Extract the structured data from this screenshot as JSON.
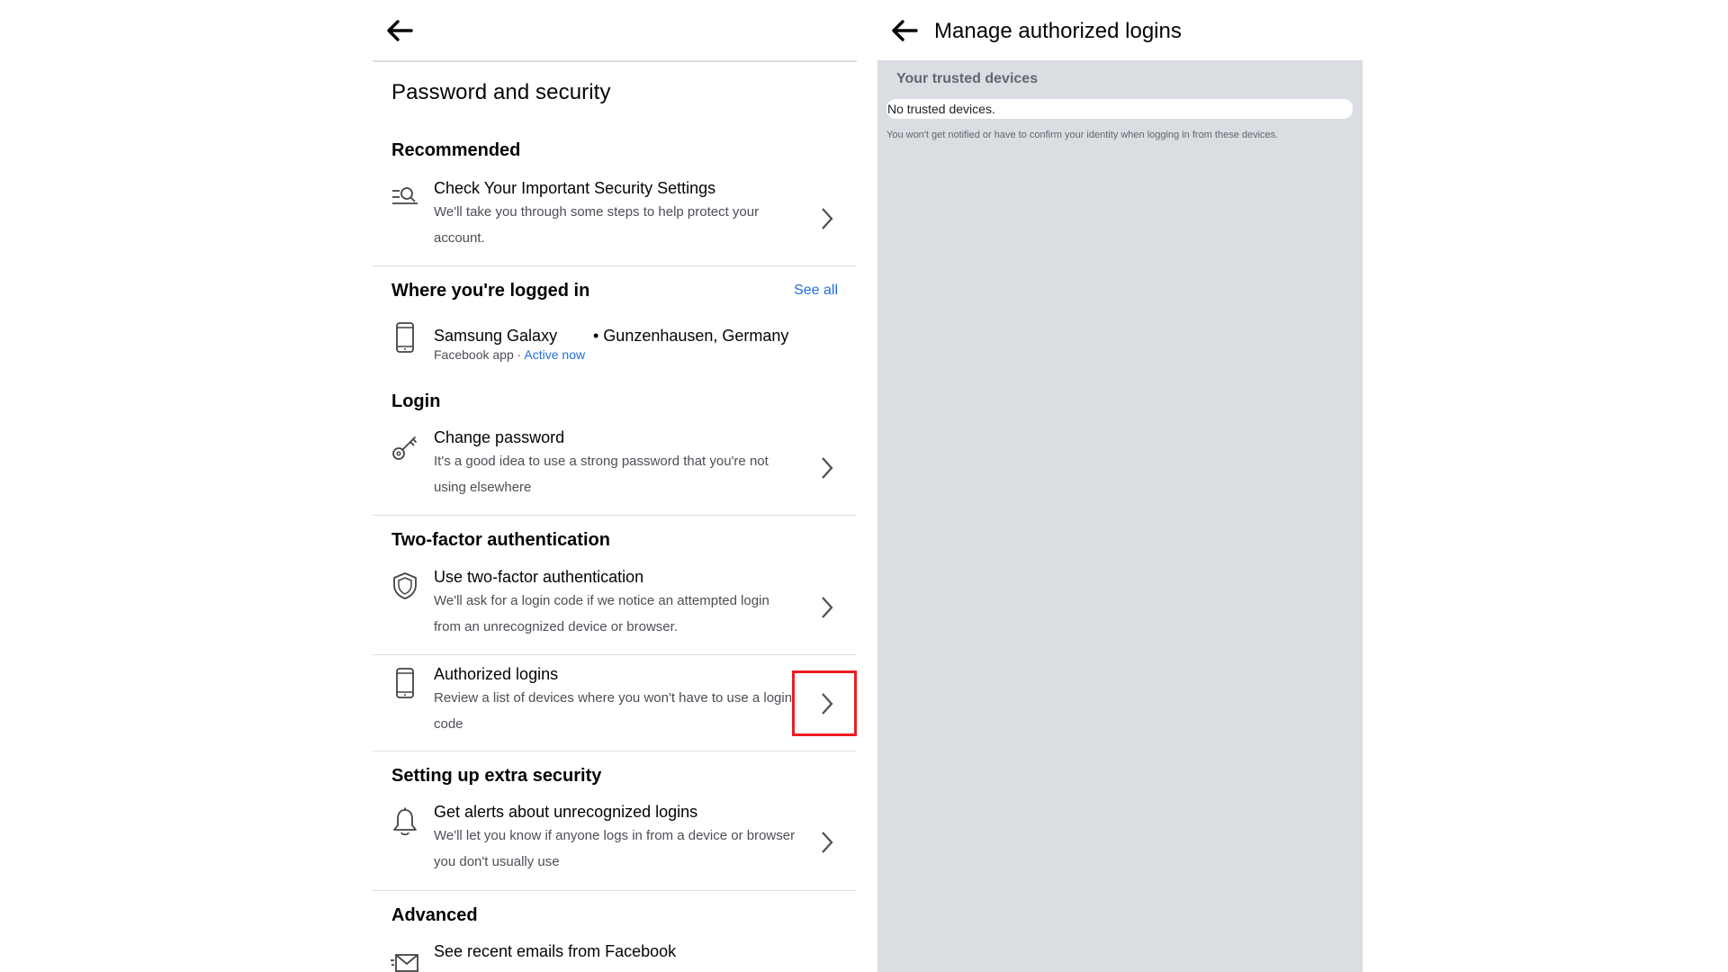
{
  "left_panel": {
    "page_title": "Password and security",
    "sections": {
      "recommended": {
        "title": "Recommended",
        "item": {
          "title": "Check Your Important Security Settings",
          "desc_line1": "We'll take you through some steps to help protect your",
          "desc_line2": "account."
        }
      },
      "logged_in": {
        "title": "Where you're logged in",
        "see_all": "See all",
        "device": {
          "name": "Samsung Galaxy",
          "location": "• Gunzenhausen, Germany",
          "app": "Facebook app · ",
          "status": "Active now"
        }
      },
      "login": {
        "title": "Login",
        "item": {
          "title": "Change password",
          "desc_line1": "It's a good idea to use a strong password that you're not",
          "desc_line2": "using elsewhere"
        }
      },
      "two_factor": {
        "title": "Two-factor authentication",
        "item1": {
          "title": "Use two-factor authentication",
          "desc_line1": "We'll ask for a login code if we notice an attempted login",
          "desc_line2": "from an unrecognized device or browser."
        },
        "item2": {
          "title": "Authorized logins",
          "desc_line1": "Review a list of devices where you won't have to use a login",
          "desc_line2": "code"
        }
      },
      "extra_security": {
        "title": "Setting up extra security",
        "item": {
          "title": "Get alerts about unrecognized logins",
          "desc_line1": "We'll let you know if anyone logs in from a device or browser",
          "desc_line2": "you don't usually use"
        }
      },
      "advanced": {
        "title": "Advanced",
        "item": {
          "title": "See recent emails from Facebook"
        }
      }
    }
  },
  "right_panel": {
    "title": "Manage authorized logins",
    "trusted_label": "Your trusted devices",
    "trusted_value": "No trusted devices.",
    "note": "You won't get notified or have to confirm your identity when logging in from these devices."
  },
  "icons": {
    "back": "arrow-left-icon",
    "search_settings": "search-list-icon",
    "phone": "phone-icon",
    "key": "key-icon",
    "shield": "shield-icon",
    "bell": "bell-icon",
    "mail": "mail-icon",
    "chevron": "chevron-right-icon"
  },
  "colors": {
    "link": "#216fdb",
    "highlight": "#ed1c24",
    "right_panel_bg": "#dadde1"
  }
}
